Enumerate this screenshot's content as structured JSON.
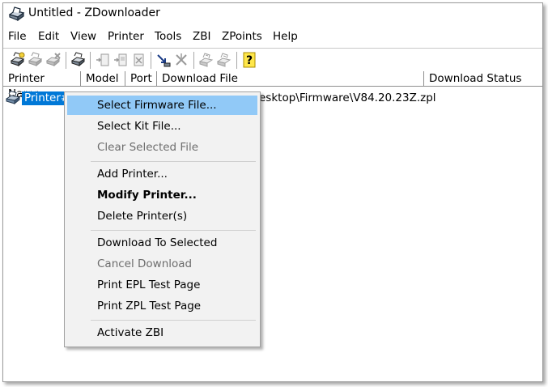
{
  "window": {
    "title": "Untitled - ZDownloader",
    "icon": "zdownloader-printer-icon"
  },
  "menubar": {
    "items": [
      "File",
      "Edit",
      "View",
      "Printer",
      "Tools",
      "ZBI",
      "ZPoints",
      "Help"
    ]
  },
  "toolbar": {
    "buttons": [
      "add-printer-icon",
      "modify-printer-icon",
      "delete-printer-icon",
      "printer-properties-icon",
      "select-firmware-icon",
      "select-kit-icon",
      "clear-file-icon",
      "download-icon",
      "cancel-download-icon",
      "epl-test-icon",
      "zpl-test-icon",
      "help-icon"
    ]
  },
  "list": {
    "columns": [
      "Printer Name",
      "Model",
      "Port",
      "Download File",
      "Download Status"
    ],
    "rows": [
      {
        "printer": "Printer#",
        "file": "esktop\\Firmware\\V84.20.23Z.zpl"
      }
    ]
  },
  "context_menu": {
    "items": [
      {
        "label": "Select Firmware File...",
        "state": "highlighted"
      },
      {
        "label": "Select Kit File...",
        "state": "normal"
      },
      {
        "label": "Clear Selected File",
        "state": "disabled"
      },
      {
        "label": "Add Printer...",
        "state": "normal"
      },
      {
        "label": "Modify Printer...",
        "state": "bold"
      },
      {
        "label": "Delete Printer(s)",
        "state": "normal"
      },
      {
        "label": "Download To Selected",
        "state": "normal"
      },
      {
        "label": "Cancel Download",
        "state": "disabled"
      },
      {
        "label": "Print EPL Test Page",
        "state": "normal"
      },
      {
        "label": "Print ZPL Test Page",
        "state": "normal"
      },
      {
        "label": "Activate ZBI",
        "state": "normal"
      }
    ]
  },
  "colors": {
    "selection": "#0078d7",
    "menu_highlight": "#91c9f7",
    "menu_background": "#f2f2f2",
    "disabled_text": "#6d6d6d"
  }
}
